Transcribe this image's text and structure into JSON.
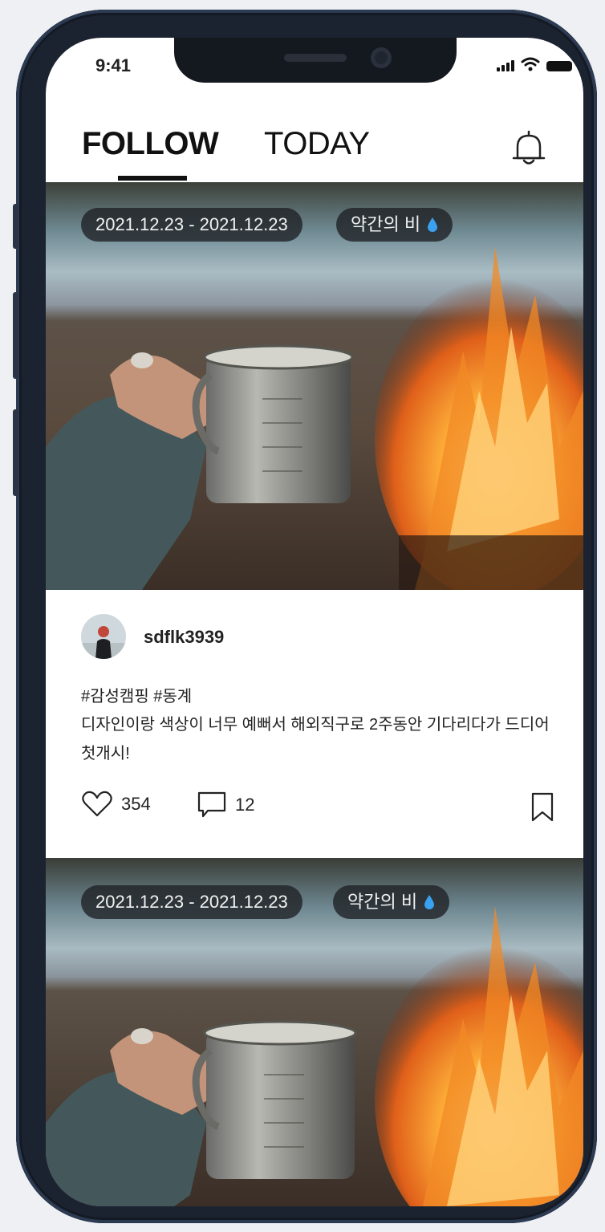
{
  "status_bar": {
    "time": "9:41"
  },
  "header": {
    "tabs": [
      {
        "label": "FOLLOW",
        "active": true
      },
      {
        "label": "TODAY",
        "active": false
      }
    ],
    "notification_icon": "bell-icon"
  },
  "posts": [
    {
      "date_range": "2021.12.23 - 2021.12.23",
      "weather": "약간의 비",
      "weather_icon": "raindrop-icon",
      "user": "sdflk3939",
      "tags": "#감성캠핑 #동계",
      "caption": "디자인이랑 색상이 너무 예뻐서 해외직구로 2주동안 기다리다가 드디어 첫개시!",
      "likes": "354",
      "comments": "12"
    },
    {
      "date_range": "2021.12.23 - 2021.12.23",
      "weather": "약간의 비",
      "weather_icon": "raindrop-icon"
    }
  ],
  "colors": {
    "raindrop": "#3aa0f0",
    "chip_bg": "#1e2024",
    "text": "#222222"
  }
}
